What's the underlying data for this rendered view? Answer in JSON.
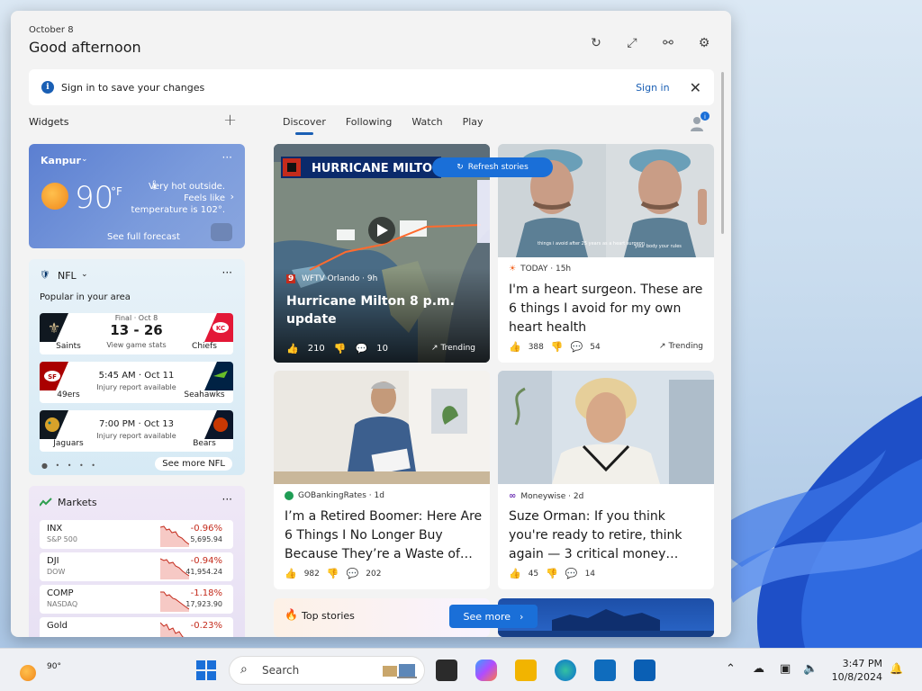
{
  "header": {
    "date": "October 8",
    "greeting": "Good afternoon"
  },
  "signin": {
    "message": "Sign in to save your changes",
    "link": "Sign in"
  },
  "widgets": {
    "title": "Widgets"
  },
  "tabs": [
    {
      "label": "Discover"
    },
    {
      "label": "Following"
    },
    {
      "label": "Watch"
    },
    {
      "label": "Play"
    }
  ],
  "weather": {
    "location": "Kanpur",
    "temp": "90",
    "unit": "°F",
    "description": "Very hot outside. Feels like temperature is 102°.",
    "forecast": "See full forecast"
  },
  "nfl": {
    "title": "NFL",
    "subtitle": "Popular in your area",
    "see_more": "See more NFL",
    "games": [
      {
        "home": "Saints",
        "away": "Chiefs",
        "status": "Final · Oct 8",
        "score": "13 - 26",
        "note": "View game stats",
        "homeColor": "#1b1b1b",
        "awayColor": "#e31837"
      },
      {
        "home": "49ers",
        "away": "Seahawks",
        "status": "",
        "score": "5:45 AM · Oct 11",
        "note": "Injury report available",
        "homeColor": "#aa0000",
        "awayColor": "#002244"
      },
      {
        "home": "Jaguars",
        "away": "Bears",
        "status": "",
        "score": "7:00 PM · Oct 13",
        "note": "Injury report available",
        "homeColor": "#006778",
        "awayColor": "#0b162a"
      }
    ]
  },
  "markets": {
    "title": "Markets",
    "rows": [
      {
        "name": "INX",
        "sub": "S&P 500",
        "change": "-0.96%",
        "value": "5,695.94"
      },
      {
        "name": "DJI",
        "sub": "DOW",
        "change": "-0.94%",
        "value": "41,954.24"
      },
      {
        "name": "COMP",
        "sub": "NASDAQ",
        "change": "-1.18%",
        "value": "17,923.90"
      },
      {
        "name": "Gold",
        "sub": "",
        "change": "-0.23%",
        "value": ""
      }
    ]
  },
  "refresh": {
    "label": "Refresh stories"
  },
  "hero": {
    "banner": "HURRICANE MILTO",
    "source": "WFTV Orlando · 9h",
    "title": "Hurricane Milton 8 p.m. update",
    "likes": "210",
    "comments": "10",
    "trend": "Trending"
  },
  "news": [
    {
      "source": "TODAY · 15h",
      "title": "I'm a heart surgeon. These are 6 things I avoid for my own heart health",
      "likes": "388",
      "comments": "54",
      "trend": "Trending",
      "caption1": "things i avoid after 25 years as a heart surgeon",
      "caption2": "your body your rules"
    },
    {
      "source": "GOBankingRates · 1d",
      "title": "I’m a Retired Boomer: Here Are 6 Things I No Longer Buy Because They’re a Waste of…",
      "likes": "982",
      "comments": "202",
      "trend": ""
    },
    {
      "source": "Moneywise · 2d",
      "title": "Suze Orman: If you think you're ready to retire, think again — 3 critical money…",
      "likes": "45",
      "comments": "14",
      "trend": ""
    }
  ],
  "topstories": {
    "title": "Top stories",
    "see_more": "See more"
  },
  "taskbar": {
    "temp": "90°",
    "search": "Search",
    "time": "3:47 PM",
    "date": "10/8/2024"
  },
  "colors": {
    "accent": "#1a6fd8",
    "negative": "#c42b1c",
    "weather": "#5b7fd1"
  }
}
